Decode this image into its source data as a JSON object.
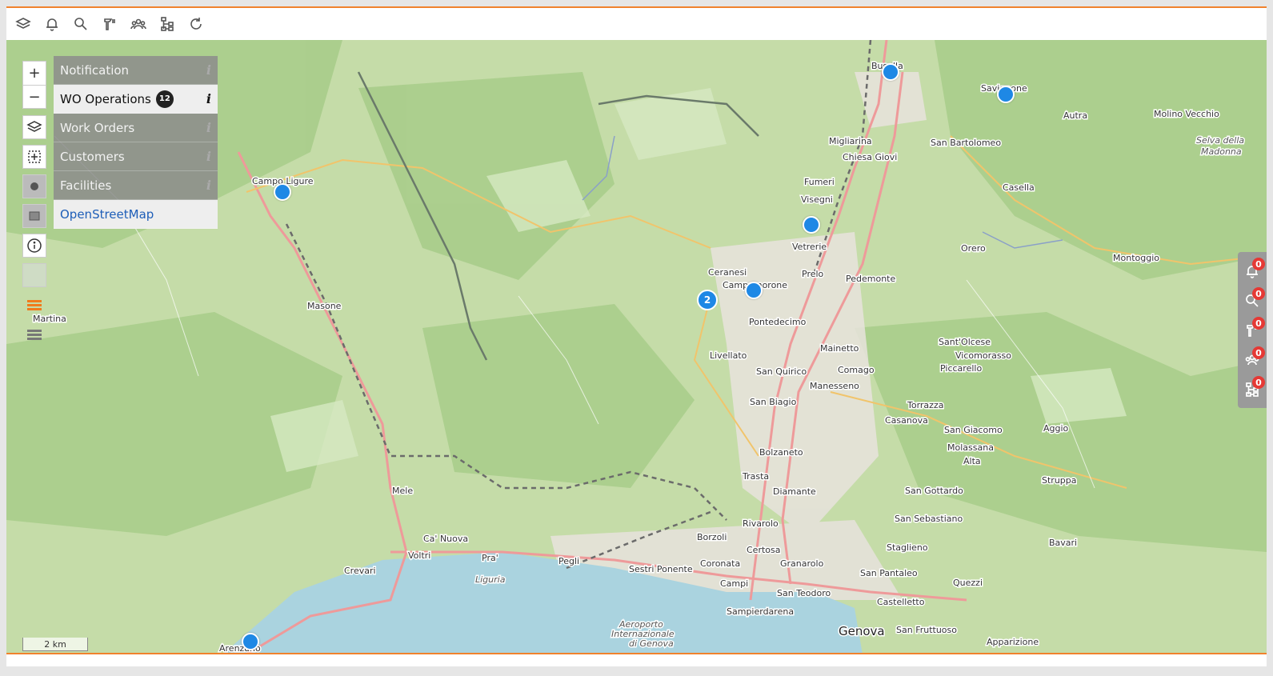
{
  "toolbar": {
    "tools": [
      {
        "icon": "layers-icon"
      },
      {
        "icon": "bell-icon"
      },
      {
        "icon": "search-icon"
      },
      {
        "icon": "work-tool-icon"
      },
      {
        "icon": "customers-icon"
      },
      {
        "icon": "hierarchy-icon"
      },
      {
        "icon": "refresh-icon"
      }
    ]
  },
  "map_controls": {
    "zoom_in": "+",
    "zoom_out": "−"
  },
  "layers": [
    {
      "label": "Notification",
      "active": false
    },
    {
      "label": "WO Operations",
      "active": true,
      "badge": "12"
    },
    {
      "label": "Work Orders",
      "active": false
    },
    {
      "label": "Customers",
      "active": false
    },
    {
      "label": "Facilities",
      "active": false
    }
  ],
  "basemap": {
    "label": "OpenStreetMap"
  },
  "info_glyph": "i",
  "cluster": {
    "count": "2"
  },
  "right_panel": [
    {
      "icon": "bell-icon",
      "count": "0"
    },
    {
      "icon": "search-icon",
      "count": "0"
    },
    {
      "icon": "work-tool-icon",
      "count": "0"
    },
    {
      "icon": "customers-icon",
      "count": "0"
    },
    {
      "icon": "hierarchy-icon",
      "count": "0"
    }
  ],
  "scale": "2 km",
  "places": [
    "Busalla",
    "Savignone",
    "Autra",
    "Molino Vecchio",
    "Selva della",
    "Madonna",
    "Migliarina",
    "Chiesa Giovi",
    "San Bartolomeo",
    "Casella",
    "Fumeri",
    "Visegni",
    "Pontedecimo",
    "Ceranesi",
    "Campomorone",
    "Prelo",
    "Vetrerie",
    "Pedemonte",
    "Orero",
    "Montoggio",
    "Campo Ligure",
    "Masone",
    "Martina",
    "Livellato",
    "San Quirico",
    "Mainetto",
    "Comago",
    "Manesseno",
    "San Biagio",
    "Sant'Olcese",
    "Vicomorasso",
    "Piccarello",
    "Torrazza",
    "Casanova",
    "San Giacomo",
    "Molassana",
    "Alta",
    "Aggio",
    "Bolzaneto",
    "Trasta",
    "Diamante",
    "San Gottardo",
    "Struppa",
    "Mele",
    "Ca' Nuova",
    "Voltri",
    "Pra'",
    "Pegli",
    "Sestri Ponente",
    "Borzoli",
    "Rivarolo",
    "Coronata",
    "Certosa",
    "Granarolo",
    "Campi",
    "San Teodoro",
    "Sampierdarena",
    "Genova",
    "Castelletto",
    "San Fruttuoso",
    "Apparizione",
    "Crevari",
    "San Sebastiano",
    "Staglieno",
    "San Pantaleo",
    "Quezzi",
    "Bavari",
    "Liguria",
    "Aeroporto",
    "Internazionale",
    "di Genova",
    "Arenzano"
  ]
}
